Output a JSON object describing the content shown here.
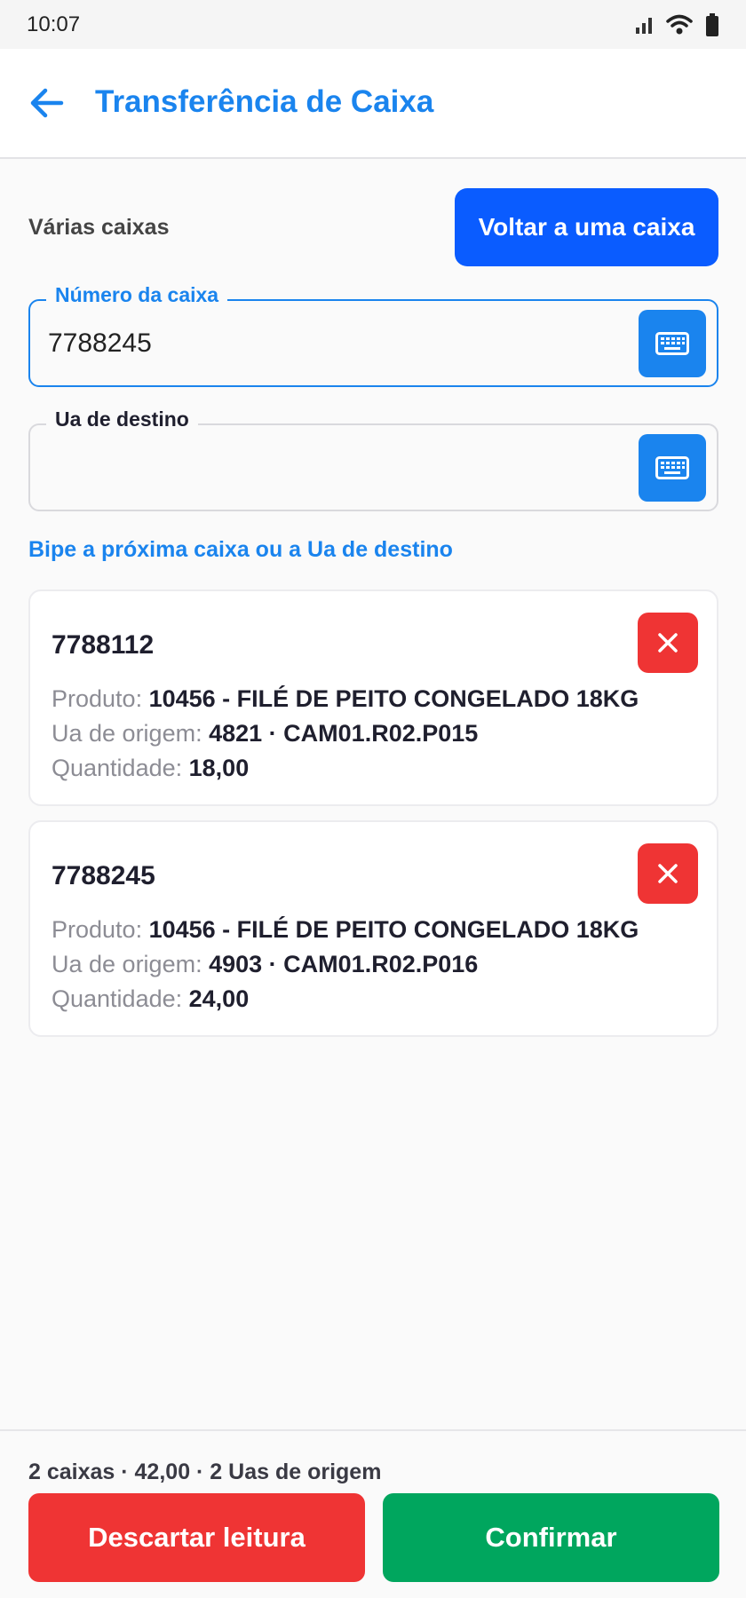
{
  "status_bar": {
    "time": "10:07"
  },
  "header": {
    "title": "Transferência de Caixa"
  },
  "mode": {
    "label": "Várias caixas",
    "button_label": "Voltar a uma caixa"
  },
  "box_field": {
    "label": "Número da caixa",
    "value": "7788245"
  },
  "destination_field": {
    "label": "Ua de destino",
    "value": ""
  },
  "hint": "Bipe a próxima caixa ou a Ua de destino",
  "field_labels": {
    "product": "Produto:",
    "origin": "Ua de origem:",
    "quantity": "Quantidade:"
  },
  "boxes": [
    {
      "id": "7788112",
      "product": "10456 - FILÉ DE PEITO CONGELADO 18KG",
      "origin": "4821 · CAM01.R02.P015",
      "quantity": "18,00"
    },
    {
      "id": "7788245",
      "product": "10456 - FILÉ DE PEITO CONGELADO 18KG",
      "origin": "4903 · CAM01.R02.P016",
      "quantity": "24,00"
    }
  ],
  "footer": {
    "summary": "2 caixas · 42,00 · 2 Uas de origem",
    "discard_label": "Descartar leitura",
    "confirm_label": "Confirmar"
  },
  "colors": {
    "primary": "#1a84ee",
    "mode_button": "#0a5cff",
    "danger": "#ef3434",
    "success": "#00a65e"
  },
  "icons": {
    "status": [
      "signal-icon",
      "wifi-icon",
      "battery-icon"
    ],
    "back": "arrow-left-icon",
    "keyboard": "keyboard-icon",
    "remove": "close-icon"
  }
}
